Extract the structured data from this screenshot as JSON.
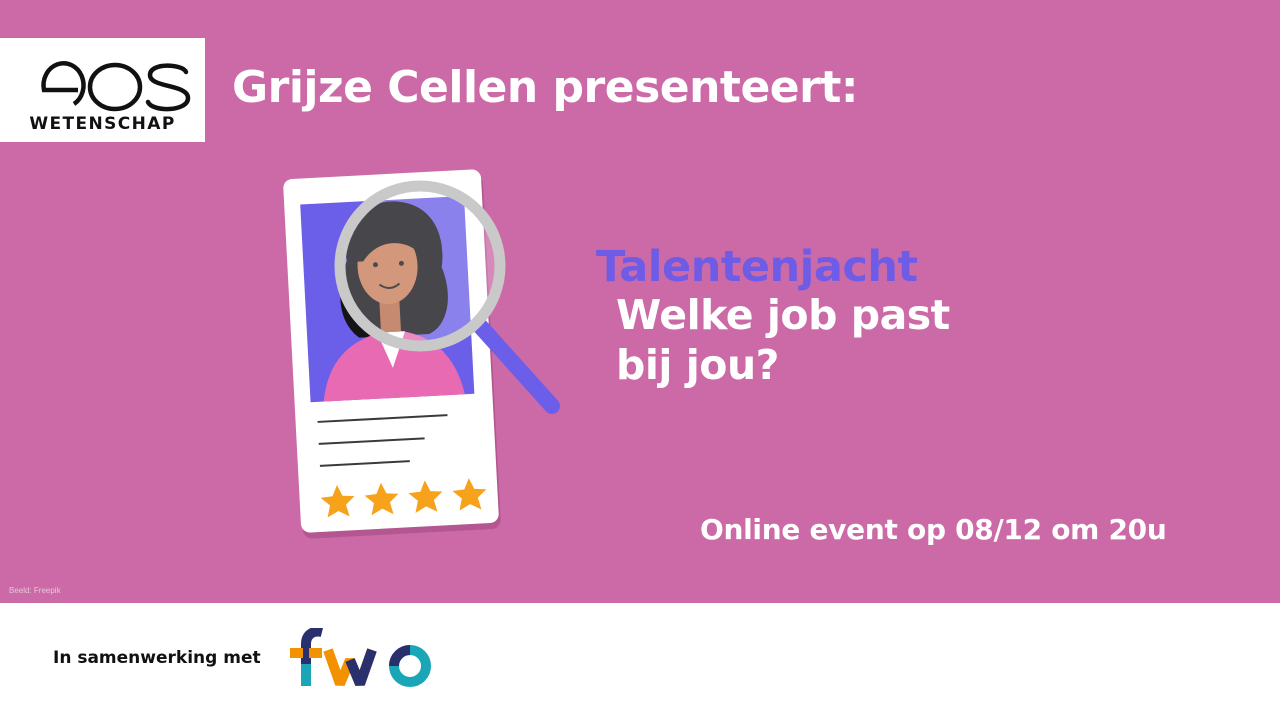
{
  "brand": {
    "logo_word": "eos",
    "logo_subtitle": "WETENSCHAP"
  },
  "headline": "Grijze Cellen presenteert:",
  "topic": {
    "title": "Talentenjacht",
    "question_line1": "Welke job past",
    "question_line2": "bij jou?"
  },
  "event_text": "Online event op 08/12 om 20u",
  "image_credit": "Beeld: Freepik",
  "partner": {
    "label": "In samenwerking met",
    "logo_word": "fwo"
  },
  "profile_card": {
    "rating_stars": 4
  },
  "colors": {
    "banner": "#cc6aa7",
    "accent_purple": "#6e5ce6",
    "star": "#f7a21b",
    "text_white": "#ffffff"
  }
}
